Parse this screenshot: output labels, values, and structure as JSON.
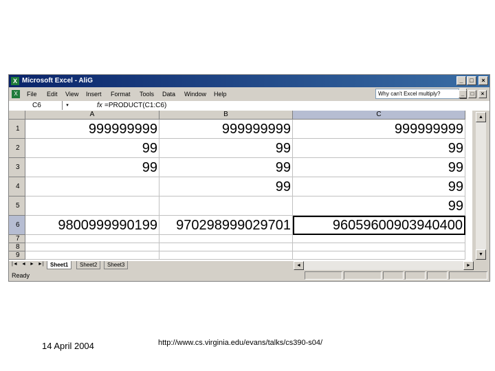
{
  "window": {
    "title": "Microsoft Excel - AliG",
    "min_label": "_",
    "max_label": "□",
    "close_label": "×",
    "doc_min_label": "_",
    "doc_max_label": "□",
    "doc_close_label": "×"
  },
  "menu": {
    "items": [
      "File",
      "Edit",
      "View",
      "Insert",
      "Format",
      "Tools",
      "Data",
      "Window",
      "Help"
    ],
    "help_box": "Why can't Excel multiply?",
    "help_drop": "▾"
  },
  "formula_bar": {
    "name_box": "C6",
    "name_drop": "▾",
    "fx": "fx",
    "formula": "=PRODUCT(C1:C6)"
  },
  "grid": {
    "columns": [
      "A",
      "B",
      "C"
    ],
    "rows": [
      "1",
      "2",
      "3",
      "4",
      "5",
      "6",
      "7",
      "8",
      "9"
    ],
    "cells": {
      "A": [
        "999999999",
        "99",
        "99",
        "",
        "",
        "9800999990199",
        "",
        "",
        ""
      ],
      "B": [
        "999999999",
        "99",
        "99",
        "99",
        "",
        "970298999029701",
        "",
        "",
        ""
      ],
      "C": [
        "999999999",
        "99",
        "99",
        "99",
        "99",
        "96059600903940400",
        "",
        "",
        ""
      ]
    },
    "active_cell": "C6"
  },
  "scrollbars": {
    "up": "▲",
    "down": "▼",
    "left": "◄",
    "right": "►"
  },
  "sheets": {
    "nav": [
      "|◄",
      "◄",
      "►",
      "►|"
    ],
    "tabs": [
      "Sheet1",
      "Sheet2",
      "Sheet3"
    ],
    "active": "Sheet1"
  },
  "status": {
    "text": "Ready"
  },
  "footer": {
    "date": "14 April 2004",
    "url": "http://www.cs.virginia.edu/evans/talks/cs390-s04/"
  }
}
